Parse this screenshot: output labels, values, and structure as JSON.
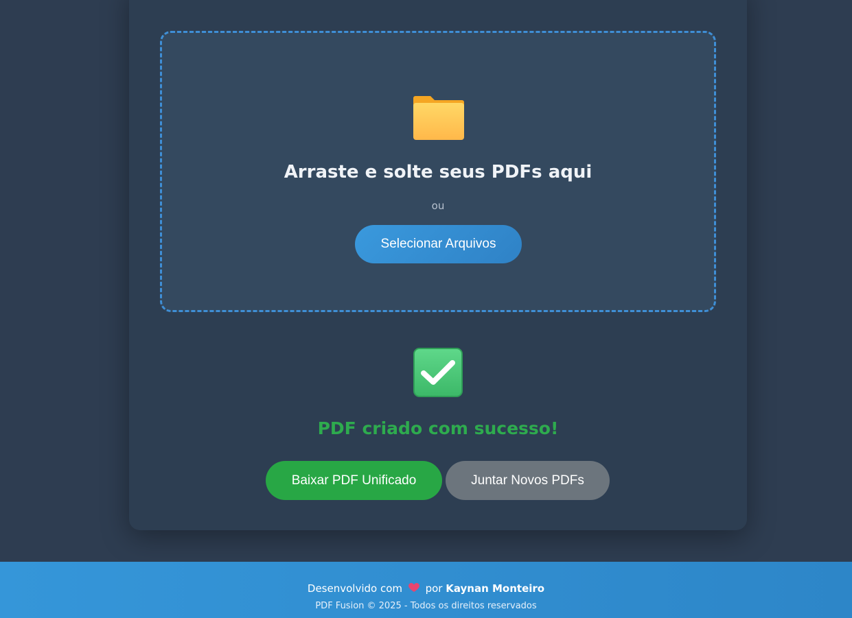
{
  "dropzone": {
    "icon": "folder-icon",
    "title": "Arraste e solte seus PDFs aqui",
    "or_text": "ou",
    "select_label": "Selecionar Arquivos"
  },
  "result": {
    "icon": "check-mark-icon",
    "message": "PDF criado com sucesso!",
    "download_label": "Baixar PDF Unificado",
    "new_label": "Juntar Novos PDFs"
  },
  "footer": {
    "developed_with": "Desenvolvido com",
    "heart_icon": "heart-icon",
    "by": "por",
    "author": "Kaynan Monteiro",
    "copyright": "PDF Fusion © 2025 - Todos os direitos reservados"
  },
  "colors": {
    "accent": "#3a99dd",
    "success": "#28a745",
    "secondary": "#6c757d",
    "background": "#2e3d51"
  }
}
